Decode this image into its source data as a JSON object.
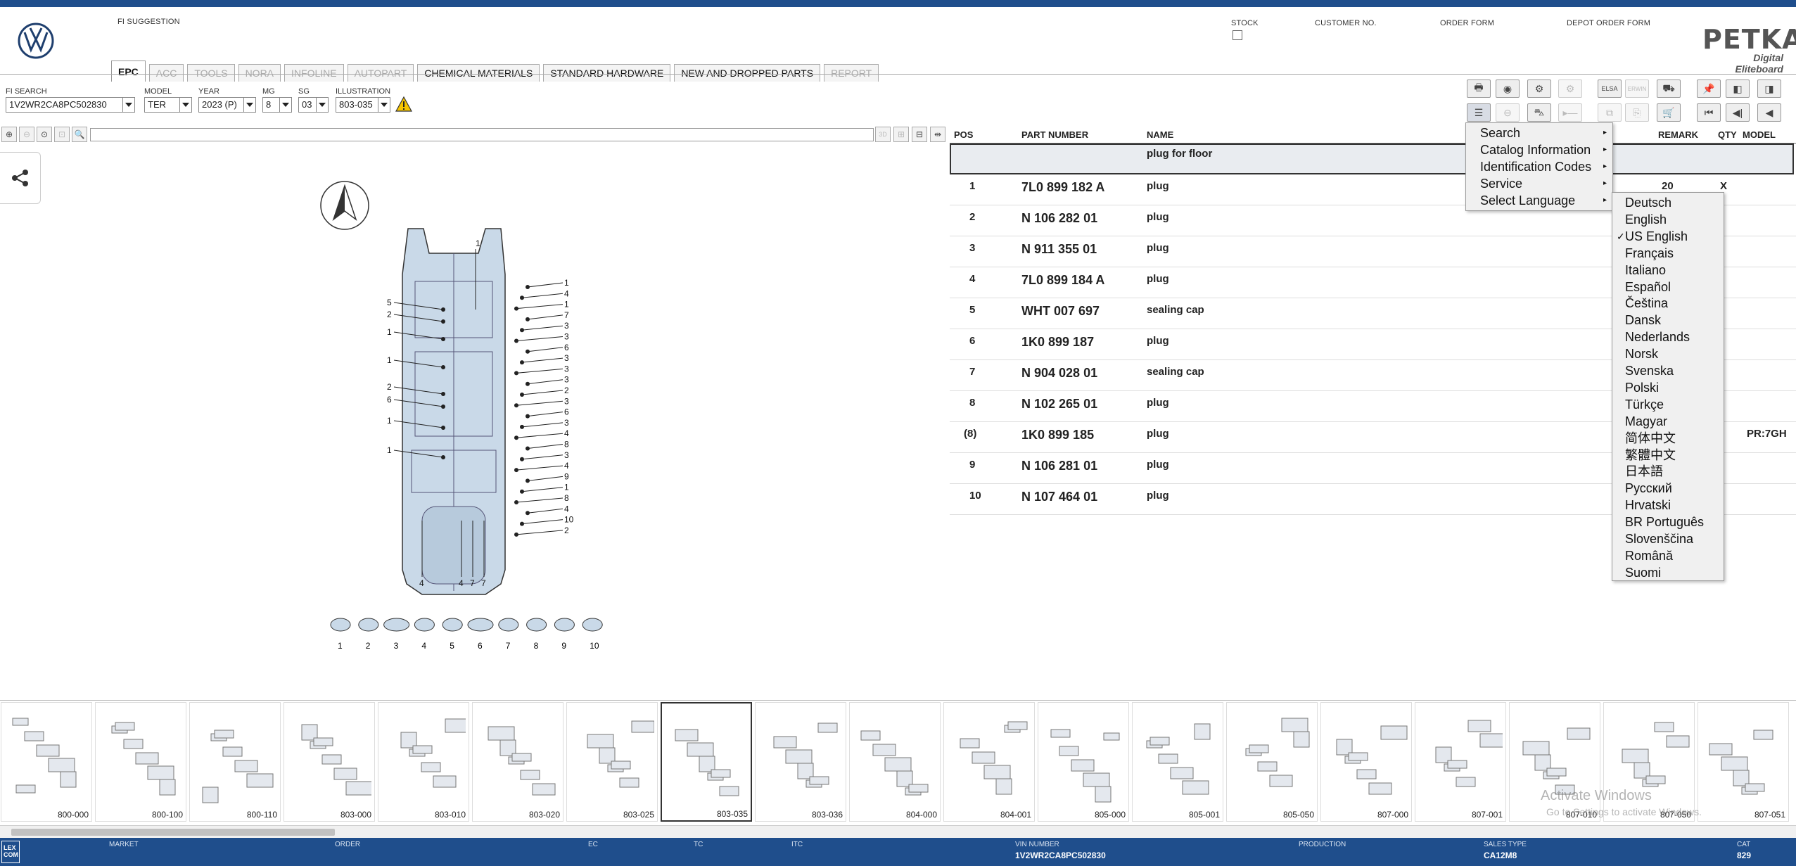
{
  "header": {
    "fi_suggestion_label": "FI SUGGESTION",
    "stock_label": "STOCK",
    "customer_no_label": "CUSTOMER NO.",
    "order_form_label": "ORDER FORM",
    "depot_order_form_label": "DEPOT ORDER FORM",
    "brand_title": "PETKA",
    "brand_subtitle": "Digital Eliteboard"
  },
  "tabs": [
    {
      "label": "EPC",
      "state": "active"
    },
    {
      "label": "ACC",
      "state": "disabled"
    },
    {
      "label": "TOOLS",
      "state": "disabled"
    },
    {
      "label": "NORA",
      "state": "disabled"
    },
    {
      "label": "INFOLINE",
      "state": "disabled"
    },
    {
      "label": "AUTOPART",
      "state": "disabled"
    },
    {
      "label": "CHEMICAL MATERIALS",
      "state": "enabled"
    },
    {
      "label": "STANDARD HARDWARE",
      "state": "enabled"
    },
    {
      "label": "NEW AND DROPPED PARTS",
      "state": "enabled"
    },
    {
      "label": "REPORT",
      "state": "disabled"
    }
  ],
  "selectors": {
    "fi_search": {
      "label": "FI SEARCH",
      "value": "1V2WR2CA8PC502830"
    },
    "model": {
      "label": "MODEL",
      "value": "TER"
    },
    "year": {
      "label": "YEAR",
      "value": "2023 (P)"
    },
    "mg": {
      "label": "MG",
      "value": "8"
    },
    "sg": {
      "label": "SG",
      "value": "03"
    },
    "illustration": {
      "label": "ILLUSTRATION",
      "value": "803-035"
    }
  },
  "parts_table": {
    "columns": {
      "pos": "POS",
      "part_number": "PART NUMBER",
      "name": "NAME",
      "remark": "REMARK",
      "qty": "QTY",
      "model": "MODEL"
    },
    "group_title": "plug for floor",
    "rows": [
      {
        "pos": "1",
        "part": "7L0 899 182 A",
        "name": "plug",
        "remark": "20",
        "qty": "X",
        "model": ""
      },
      {
        "pos": "2",
        "part": "N   106 282 01",
        "name": "plug",
        "remark": "",
        "qty": "",
        "model": ""
      },
      {
        "pos": "3",
        "part": "N   911 355 01",
        "name": "plug",
        "remark": "",
        "qty": "",
        "model": ""
      },
      {
        "pos": "4",
        "part": "7L0 899 184 A",
        "name": "plug",
        "remark": "",
        "qty": "",
        "model": ""
      },
      {
        "pos": "5",
        "part": "WHT 007 697",
        "name": "sealing cap",
        "remark": "",
        "qty": "",
        "model": ""
      },
      {
        "pos": "6",
        "part": "1K0 899 187",
        "name": "plug",
        "remark": "",
        "qty": "",
        "model": ""
      },
      {
        "pos": "7",
        "part": "N   904 028 01",
        "name": "sealing cap",
        "remark": "",
        "qty": "",
        "model": ""
      },
      {
        "pos": "8",
        "part": "N   102 265 01",
        "name": "plug",
        "remark": "",
        "qty": "",
        "model": ""
      },
      {
        "pos": "(8)",
        "part": "1K0 899 185",
        "name": "plug",
        "remark": "",
        "qty": "",
        "model": "PR:7GH"
      },
      {
        "pos": "9",
        "part": "N   106 281 01",
        "name": "plug",
        "remark": "",
        "qty": "",
        "model": ""
      },
      {
        "pos": "10",
        "part": "N   107 464 01",
        "name": "plug",
        "remark": "",
        "qty": "",
        "model": ""
      }
    ]
  },
  "context_menu": {
    "items": [
      "Search",
      "Catalog Information",
      "Identification Codes",
      "Service",
      "Select Language"
    ]
  },
  "language_menu": {
    "selected": "US English",
    "items": [
      "Deutsch",
      "English",
      "US English",
      "Français",
      "Italiano",
      "Español",
      "Čeština",
      "Dansk",
      "Nederlands",
      "Norsk",
      "Svenska",
      "Polski",
      "Türkçe",
      "Magyar",
      "简体中文",
      "繁體中文",
      "日本語",
      "Русский",
      "Hrvatski",
      "BR Português",
      "Slovenščina",
      "Română",
      "Suomi"
    ]
  },
  "illustration": {
    "callouts_left": [
      "5",
      "2",
      "1",
      "1",
      "2",
      "6",
      "1",
      "1"
    ],
    "callouts_right": [
      "1",
      "4",
      "1",
      "7",
      "3",
      "3",
      "6",
      "3",
      "3",
      "3",
      "2",
      "3",
      "6",
      "3",
      "4",
      "8",
      "3",
      "4",
      "9",
      "1",
      "8",
      "4",
      "10",
      "2"
    ],
    "callout_top": "1",
    "callouts_bottom": [
      "4",
      "4",
      "7",
      "7"
    ],
    "legend_labels": [
      "1",
      "2",
      "3",
      "4",
      "5",
      "6",
      "7",
      "8",
      "9",
      "10"
    ]
  },
  "thumbnails": [
    "800-000",
    "800-100",
    "800-110",
    "803-000",
    "803-010",
    "803-020",
    "803-025",
    "803-035",
    "803-036",
    "804-000",
    "804-001",
    "805-000",
    "805-001",
    "805-050",
    "807-000",
    "807-001",
    "807-010",
    "807-050",
    "807-051"
  ],
  "selected_thumbnail": "803-035",
  "watermark": {
    "line1": "Activate Windows",
    "line2": "Go to Settings to activate Windows."
  },
  "status_bar": {
    "logo": "LEX COM",
    "market_label": "MARKET",
    "market_value": "",
    "order_label": "ORDER",
    "order_value": "",
    "ec_label": "EC",
    "ec_value": "",
    "tc_label": "TC",
    "tc_value": "",
    "itc_label": "ITC",
    "itc_value": "",
    "vin_label": "VIN NUMBER",
    "vin_value": "1V2WR2CA8PC502830",
    "production_label": "PRODUCTION",
    "production_value": "",
    "sales_type_label": "SALES TYPE",
    "sales_type_value": "CA12M8",
    "cat_label": "CAT",
    "cat_value": "829"
  },
  "colors": {
    "top_bar": "#1f4e8c",
    "status_bar": "#1f4e8c",
    "illustration_fill": "#c9d9e8"
  }
}
